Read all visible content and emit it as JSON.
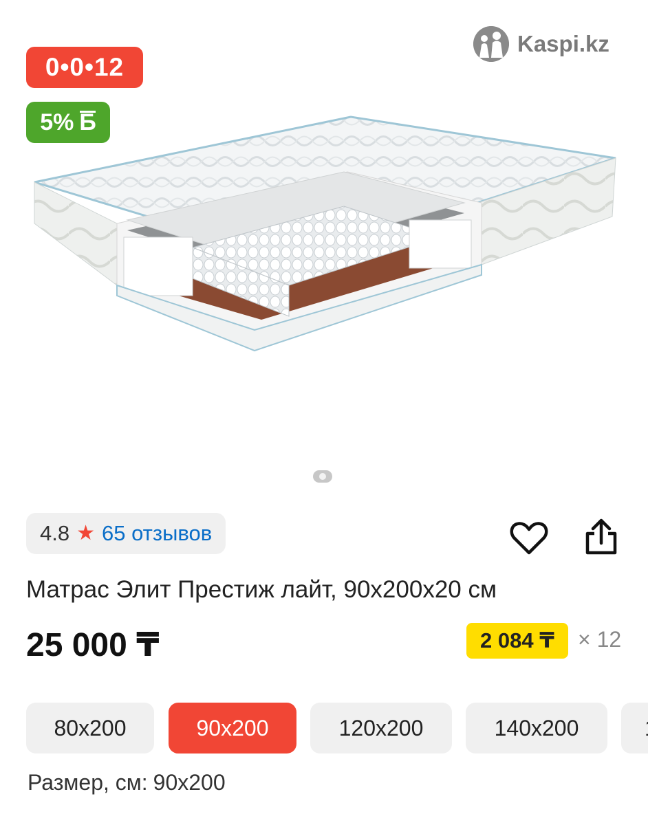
{
  "badges": {
    "installment": "0•0•12",
    "bonus_percent": "5%",
    "bonus_icon": "Б"
  },
  "brand": {
    "name": "Kaspi.kz",
    "logo_icon": "kaspi-logo-icon"
  },
  "gallery": {
    "current_image": 1,
    "total_images": 1
  },
  "rating": {
    "value": "4.8",
    "icon": "star-icon",
    "reviews": "65 отзывов"
  },
  "actions": {
    "favorite_icon": "heart-icon",
    "share_icon": "share-icon"
  },
  "product": {
    "title": "Матрас Элит Престиж лайт, 90x200x20 см",
    "price": "25 000 ₸",
    "monthly_payment": "2 084 ₸",
    "months": "× 12"
  },
  "sizes": {
    "options": [
      "80x200",
      "90x200",
      "120x200",
      "140x200",
      "1"
    ],
    "selected": "90x200",
    "caption_label": "Размер, см:",
    "caption_value": "90x200"
  },
  "colors": {
    "accent_red": "#f14635",
    "bonus_green": "#4ea62b",
    "highlight_yellow": "#ffdd00",
    "link_blue": "#0a6ec8"
  }
}
